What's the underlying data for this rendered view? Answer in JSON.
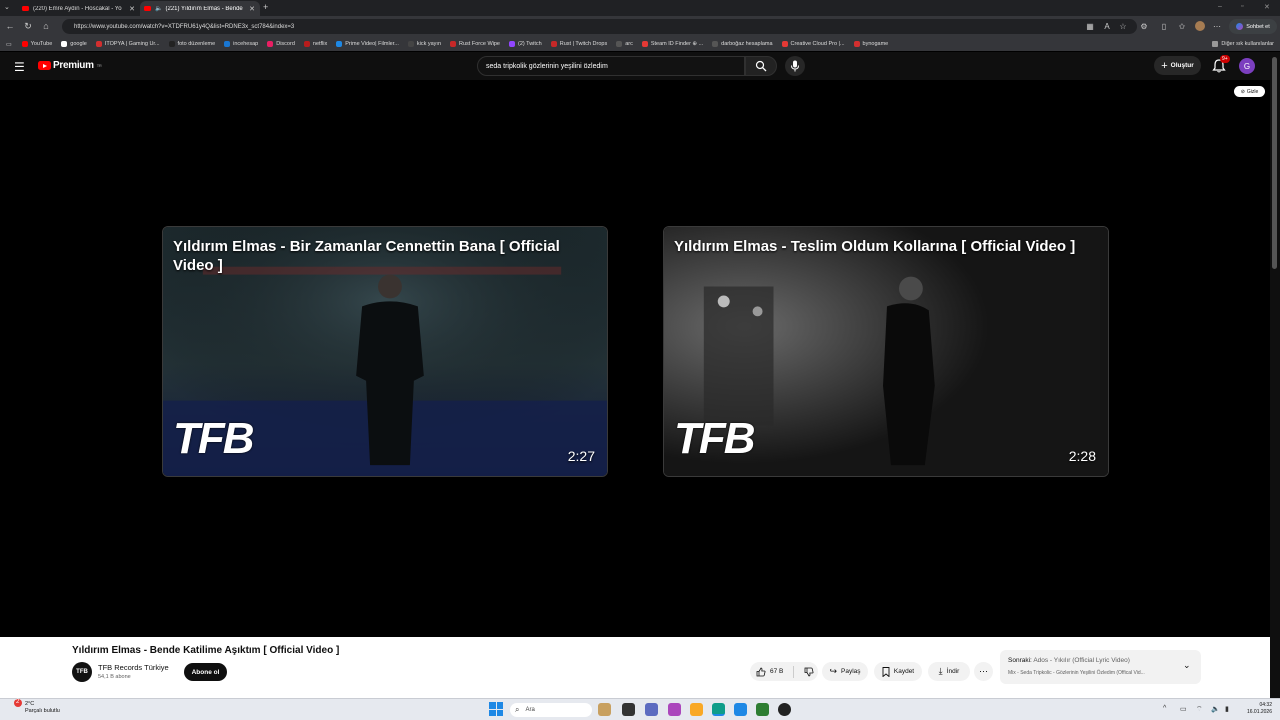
{
  "browser": {
    "tabs": [
      {
        "title": "(220) Emre Aydın - Hoscakal - Yo",
        "active": false
      },
      {
        "title": "(221) Yıldırım Elmas - Bende",
        "active": true
      }
    ],
    "url": "https://www.youtube.com/watch?v=XTDFRU61y4Q&list=RDNE3x_sct784&index=3",
    "chat_button": "Sohbet et",
    "bookmarks": [
      {
        "label": "YouTube",
        "color": "#ff0000"
      },
      {
        "label": "google",
        "color": "#ffffff"
      },
      {
        "label": "ITOPYA | Gaming Ür...",
        "color": "#d32f2f"
      },
      {
        "label": "foto düzenleme",
        "color": "#222222"
      },
      {
        "label": "incehesap",
        "color": "#1976d2"
      },
      {
        "label": "Discord",
        "color": "#e91e63"
      },
      {
        "label": "netflix",
        "color": "#b71c1c"
      },
      {
        "label": "Prime Video| Filmler...",
        "color": "#1e88e5"
      },
      {
        "label": "kick yayın",
        "color": "#444444"
      },
      {
        "label": "Rust Force Wipe",
        "color": "#c62828"
      },
      {
        "label": "(2) Twitch",
        "color": "#9146ff"
      },
      {
        "label": "Rust | Twitch Drops",
        "color": "#c62828"
      },
      {
        "label": "arc",
        "color": "#555555"
      },
      {
        "label": "Steam ID Finder ⊕ ...",
        "color": "#e53935"
      },
      {
        "label": "darboğaz hesaplama",
        "color": "#555555"
      },
      {
        "label": "Creative Cloud Pro |...",
        "color": "#e53935"
      },
      {
        "label": "bynogame",
        "color": "#d32f2f"
      }
    ],
    "other_bookmarks": "Diğer sık kullanılanlar"
  },
  "header": {
    "logo_text": "Premium",
    "logo_sup": "TR",
    "search_value": "seda tripkolik gözlerinin yeşilini özledim",
    "create_label": "Oluştur",
    "notification_count": "9+",
    "avatar_letter": "G"
  },
  "player": {
    "hide_label": "Gizle",
    "suggestions": [
      {
        "title": "Yıldırım Elmas - Bir Zamanlar Cennettin Bana [ Official Video ]",
        "logo": "TFB",
        "duration": "2:27"
      },
      {
        "title": "Yıldırım Elmas - Teslim Oldum Kollarına [ Official Video ]",
        "logo": "TFB",
        "duration": "2:28"
      }
    ]
  },
  "video": {
    "title": "Yıldırım Elmas - Bende Katilime Aşıktım [ Official Video ]",
    "channel_avatar": "TFB",
    "channel": "TFB Records Türkiye",
    "subscribers": "54,1 B abone",
    "subscribe_label": "Abone ol",
    "likes": "67 B",
    "share_label": "Paylaş",
    "save_label": "Kaydet",
    "download_label": "İndir",
    "next_prefix": "Sonraki:",
    "next_title": "Ados - Yıkılır (Official Lyric Video)",
    "next_sub": "Mix - Seda Tripkolic - Gözlerinin Yeşilini Özledim (Offical Vid..."
  },
  "taskbar": {
    "weather_temp": "2°C",
    "weather_desc": "Parçalı bulutlu",
    "weather_badge": "2",
    "search_placeholder": "Ara",
    "time": "04:32",
    "date": "16.01.2026"
  }
}
